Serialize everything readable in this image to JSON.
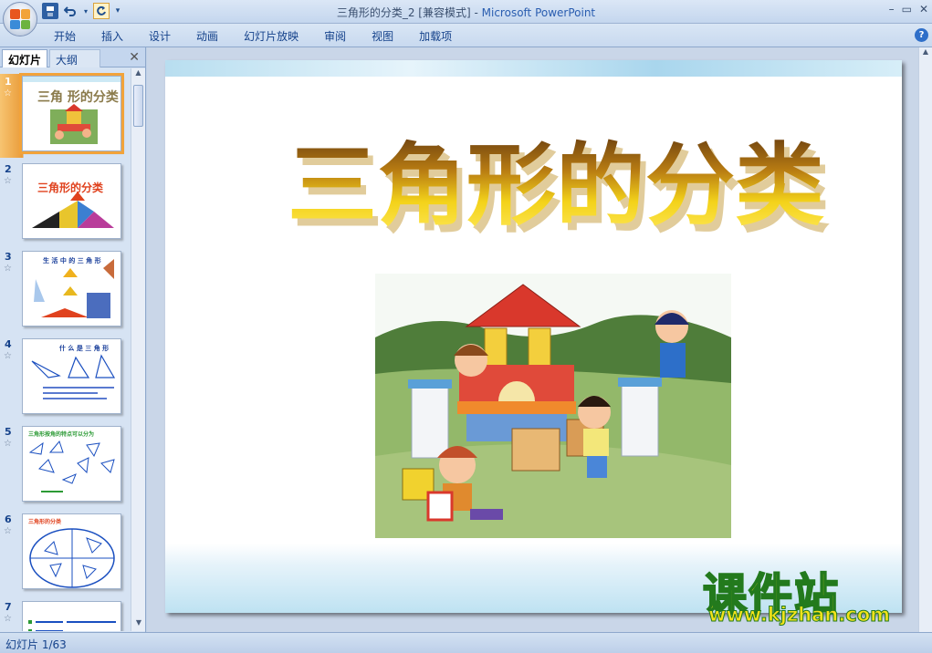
{
  "window": {
    "title": "三角形的分类_2 [兼容模式]",
    "separator": " - ",
    "app_name": "Microsoft PowerPoint",
    "controls": [
      "–",
      "▭",
      "✕"
    ]
  },
  "quick_access": {
    "save": "save-icon",
    "undo": "undo-icon",
    "repeat": "repeat-icon",
    "customize": "▾"
  },
  "ribbon": {
    "tabs": [
      "开始",
      "插入",
      "设计",
      "动画",
      "幻灯片放映",
      "审阅",
      "视图",
      "加载项"
    ]
  },
  "pane": {
    "tab_slides": "幻灯片",
    "tab_outline": "大纲",
    "close": "✕",
    "slides": [
      {
        "num": "1",
        "title": "三角 形的分类"
      },
      {
        "num": "2",
        "title": "三角形的分类"
      },
      {
        "num": "3",
        "title": "生 活 中 的 三 角 形"
      },
      {
        "num": "4",
        "title": "什 么 是 三 角 形"
      },
      {
        "num": "5",
        "title": "三角形按角的特点可以分为"
      },
      {
        "num": "6",
        "title": "三角形的分类"
      },
      {
        "num": "7",
        "title": ""
      }
    ]
  },
  "slide": {
    "title": "三角形的分类"
  },
  "status": {
    "text": "幻灯片 1/63"
  },
  "watermark": {
    "big": "课件站",
    "small": "www.kjzhan.com"
  },
  "colors": {
    "accent": "#f2a33a",
    "ribbon_text": "#15428b",
    "title_gold": "#e8b400"
  }
}
